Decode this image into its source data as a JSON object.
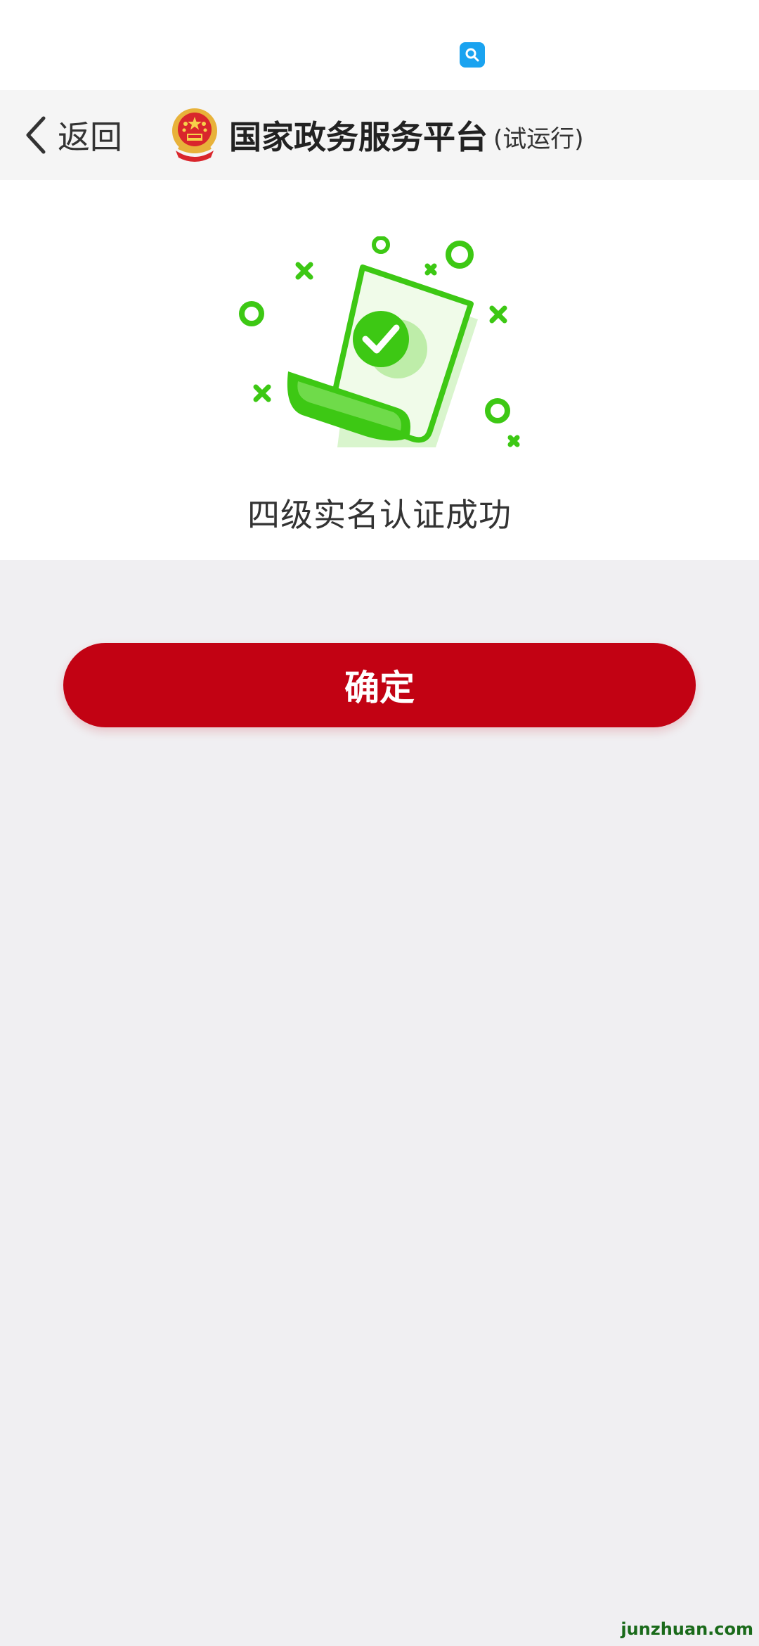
{
  "status_bar": {
    "icon": "search-icon"
  },
  "nav": {
    "back_label": "返回",
    "title": "国家政务服务平台",
    "title_suffix": "(试运行)",
    "emblem_icon": "national-emblem-icon"
  },
  "result": {
    "message": "四级实名认证成功",
    "illustration_icon": "document-check-icon"
  },
  "actions": {
    "confirm_label": "确定"
  },
  "watermark": "junzhuan.com",
  "colors": {
    "accent": "#c20213",
    "success": "#3dc814",
    "page_bg": "#f0eff2"
  }
}
